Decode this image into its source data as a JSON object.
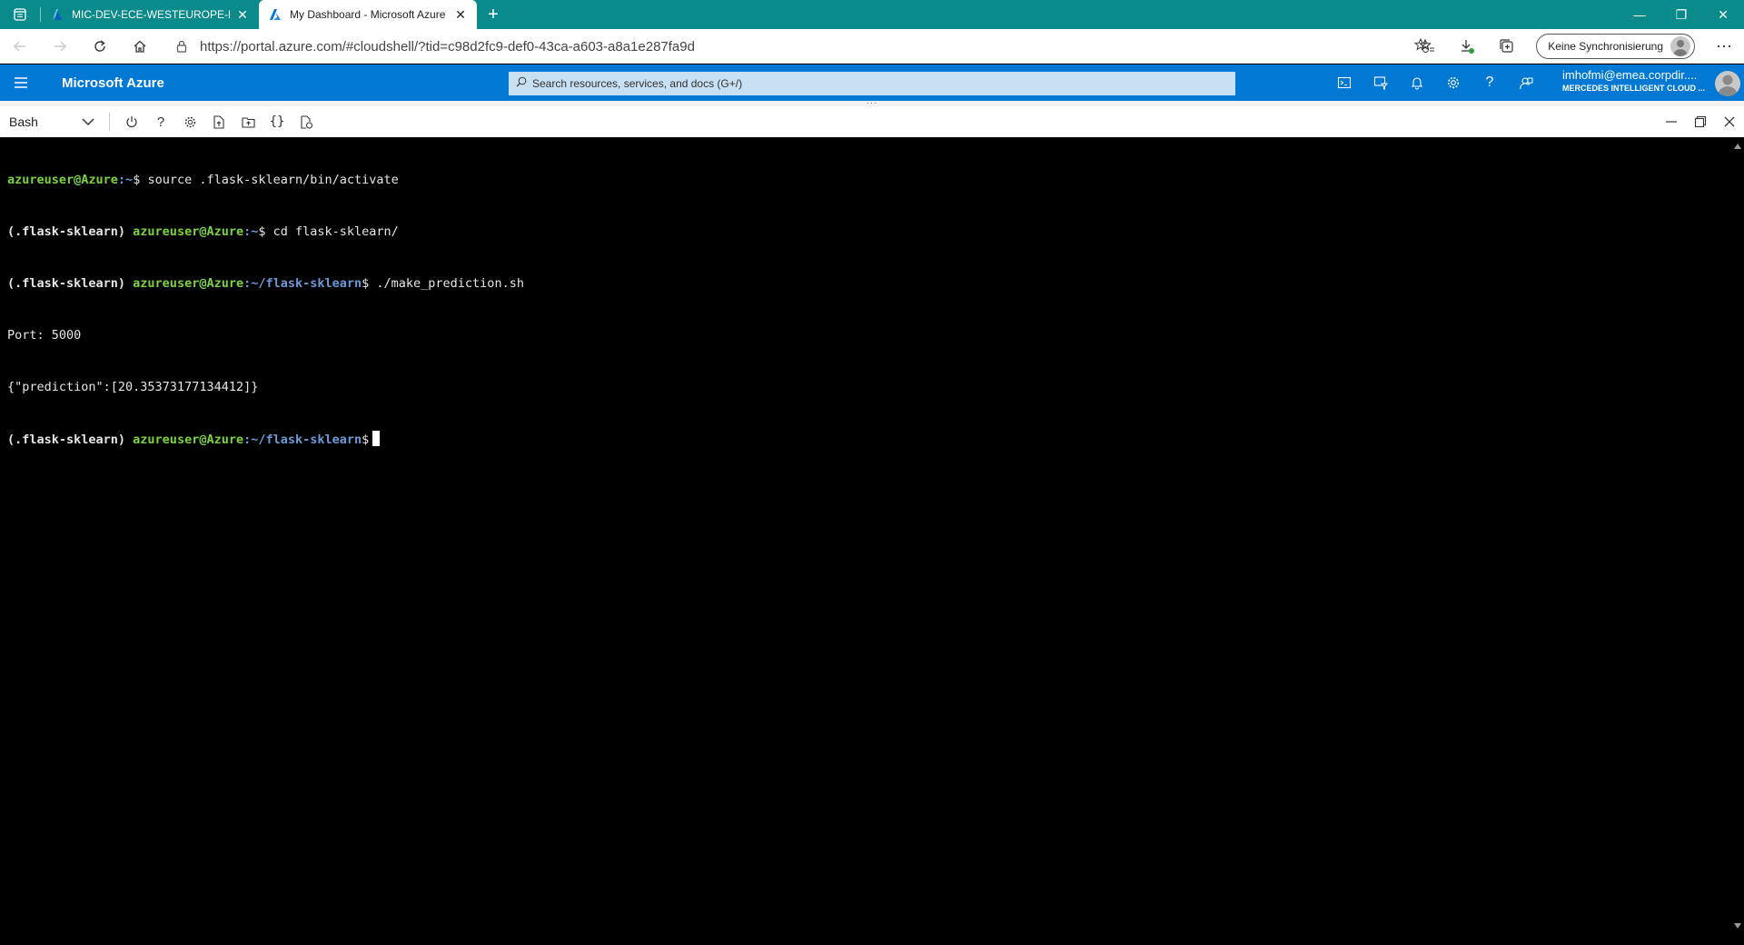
{
  "browser": {
    "tabs": [
      {
        "title": "MIC-DEV-ECE-WESTEUROPE-DD",
        "active": false
      },
      {
        "title": "My Dashboard - Microsoft Azure",
        "active": true
      }
    ],
    "address": {
      "url": "https://portal.azure.com/#cloudshell/?tid=c98d2fc9-def0-43ca-a603-a8a1e287fa9d"
    },
    "sync_label": "Keine Synchronisierung"
  },
  "azure": {
    "brand": "Microsoft Azure",
    "search_placeholder": "Search resources, services, and docs (G+/)",
    "user_email": "imhofmi@emea.corpdir....",
    "user_org": "MERCEDES INTELLIGENT CLOUD ...",
    "brand_color": "#0078d4"
  },
  "shell": {
    "selected_shell": "Bash",
    "icons": [
      "power-icon",
      "help-icon",
      "settings-icon",
      "upload-icon",
      "open-folder-icon",
      "editor-braces-icon",
      "web-preview-icon"
    ]
  },
  "terminal": {
    "line1_user": "azureuser@Azure",
    "line1_path": ":~",
    "line1_cmd": "$ source .flask-sklearn/bin/activate",
    "line2_env": "(.flask-sklearn) ",
    "line2_user": "azureuser@Azure",
    "line2_path": ":~",
    "line2_cmd": "$ cd flask-sklearn/",
    "line3_env": "(.flask-sklearn) ",
    "line3_user": "azureuser@Azure",
    "line3_path": ":~/flask-sklearn",
    "line3_cmd": "$ ./make_prediction.sh",
    "line4": "Port: 5000",
    "line5": "{\"prediction\":[20.35373177134412]}",
    "line6_env": "(.flask-sklearn) ",
    "line6_user": "azureuser@Azure",
    "line6_path": ":~/flask-sklearn",
    "line6_cmd": "$"
  }
}
